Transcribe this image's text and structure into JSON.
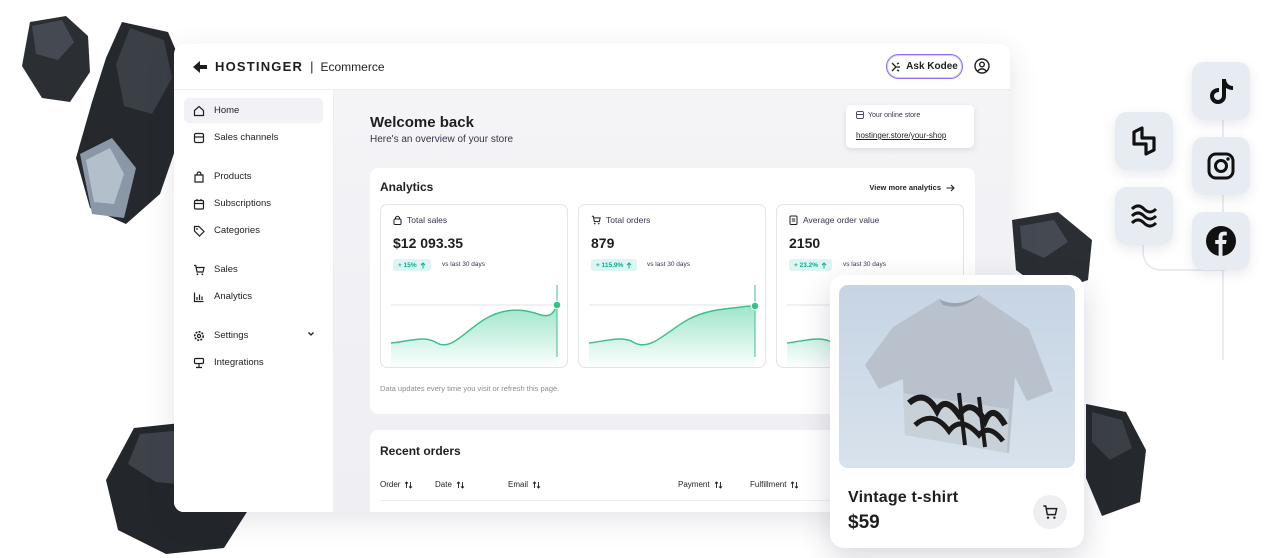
{
  "header": {
    "brand_name": "HOSTINGER",
    "brand_separator": "|",
    "brand_product": "Ecommerce",
    "ask_button": "Ask Kodee"
  },
  "sidebar": {
    "items": [
      {
        "label": "Home",
        "icon": "home-icon",
        "active": true
      },
      {
        "label": "Sales channels",
        "icon": "channels-icon"
      },
      {
        "label": "Products",
        "icon": "bag-icon"
      },
      {
        "label": "Subscriptions",
        "icon": "calendar-icon"
      },
      {
        "label": "Categories",
        "icon": "tag-icon"
      },
      {
        "label": "Sales",
        "icon": "cart-icon"
      },
      {
        "label": "Analytics",
        "icon": "bar-chart-icon"
      },
      {
        "label": "Settings",
        "icon": "gear-icon"
      },
      {
        "label": "Integrations",
        "icon": "integrations-icon"
      }
    ]
  },
  "main": {
    "welcome_title": "Welcome back",
    "welcome_subtitle": "Here's an overview of your store",
    "store": {
      "label": "Your online store",
      "url": "hostinger.store/your-shop"
    },
    "analytics": {
      "title": "Analytics",
      "view_more": "View more analytics",
      "note": "Data updates every time you visit or refresh this page.",
      "metrics": [
        {
          "label": "Total sales",
          "value": "$12 093.35",
          "change": "+ 15%",
          "compare": "vs last 30 days",
          "icon": "lock-icon"
        },
        {
          "label": "Total orders",
          "value": "879",
          "change": "+ 115.9%",
          "compare": "vs last 30 days",
          "icon": "cart-icon"
        },
        {
          "label": "Average order value",
          "value": "2150",
          "change": "+ 23.2%",
          "compare": "vs last 30 days",
          "icon": "receipt-icon"
        }
      ]
    },
    "recent_orders": {
      "title": "Recent orders",
      "columns": [
        "Order",
        "Date",
        "Email",
        "Payment",
        "Fulfillment"
      ]
    }
  },
  "product_card": {
    "name": "Vintage t-shirt",
    "price": "$59"
  },
  "social_tiles": [
    "tiktok-icon",
    "hostinger-icon",
    "instagram-icon",
    "layers-icon",
    "facebook-icon"
  ],
  "colors": {
    "accent_green": "#00b090",
    "badge_bg": "#def4f0",
    "ask_border": "#8c6cf7",
    "main_bg": "#f4f4f7"
  }
}
